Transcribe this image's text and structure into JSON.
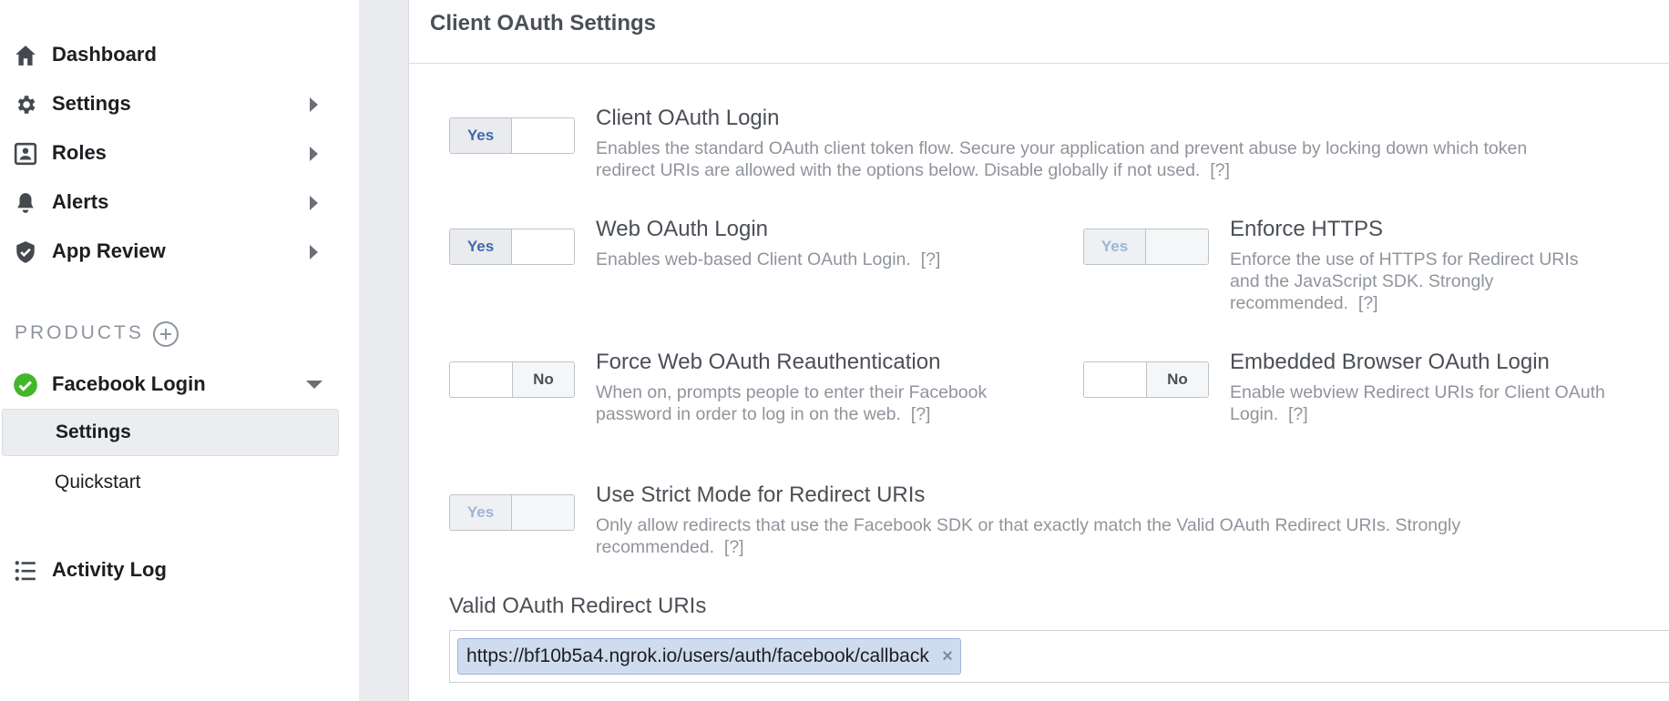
{
  "sidebar": {
    "items": [
      {
        "label": "Dashboard",
        "icon": "home-icon"
      },
      {
        "label": "Settings",
        "icon": "gear-icon"
      },
      {
        "label": "Roles",
        "icon": "roles-icon"
      },
      {
        "label": "Alerts",
        "icon": "bell-icon"
      },
      {
        "label": "App Review",
        "icon": "shield-check-icon"
      }
    ],
    "products_heading": "PRODUCTS",
    "product": {
      "label": "Facebook Login",
      "icon": "check-circle-icon"
    },
    "sub_items": [
      {
        "label": "Settings",
        "active": true
      },
      {
        "label": "Quickstart",
        "active": false
      }
    ],
    "activity_log": {
      "label": "Activity Log",
      "icon": "list-icon"
    }
  },
  "panel": {
    "title": "Client OAuth Settings",
    "options": {
      "client_oauth_login": {
        "title": "Client OAuth Login",
        "description": "Enables the standard OAuth client token flow. Secure your application and prevent abuse by locking down which token redirect URIs are allowed with the options below. Disable globally if not used.",
        "state": "Yes"
      },
      "web_oauth_login": {
        "title": "Web OAuth Login",
        "description": "Enables web-based Client OAuth Login.",
        "state": "Yes"
      },
      "enforce_https": {
        "title": "Enforce HTTPS",
        "description": "Enforce the use of HTTPS for Redirect URIs and the JavaScript SDK. Strongly recommended.",
        "state": "Yes"
      },
      "force_reauth": {
        "title": "Force Web OAuth Reauthentication",
        "description": "When on, prompts people to enter their Facebook password in order to log in on the web.",
        "state": "No"
      },
      "embedded_browser": {
        "title": "Embedded Browser OAuth Login",
        "description": "Enable webview Redirect URIs for Client OAuth Login.",
        "state": "No"
      },
      "strict_mode": {
        "title": "Use Strict Mode for Redirect URIs",
        "description": "Only allow redirects that use the Facebook SDK or that exactly match the Valid OAuth Redirect URIs. Strongly recommended.",
        "state": "Yes"
      }
    },
    "help_link": "[?]",
    "redirect_uris": {
      "label": "Valid OAuth Redirect URIs",
      "values": [
        "https://bf10b5a4.ngrok.io/users/auth/facebook/callback"
      ],
      "remove_glyph": "×"
    }
  },
  "colors": {
    "accent_blue": "#4267b2",
    "check_green": "#42b72a",
    "gutter": "#e9ebee"
  }
}
